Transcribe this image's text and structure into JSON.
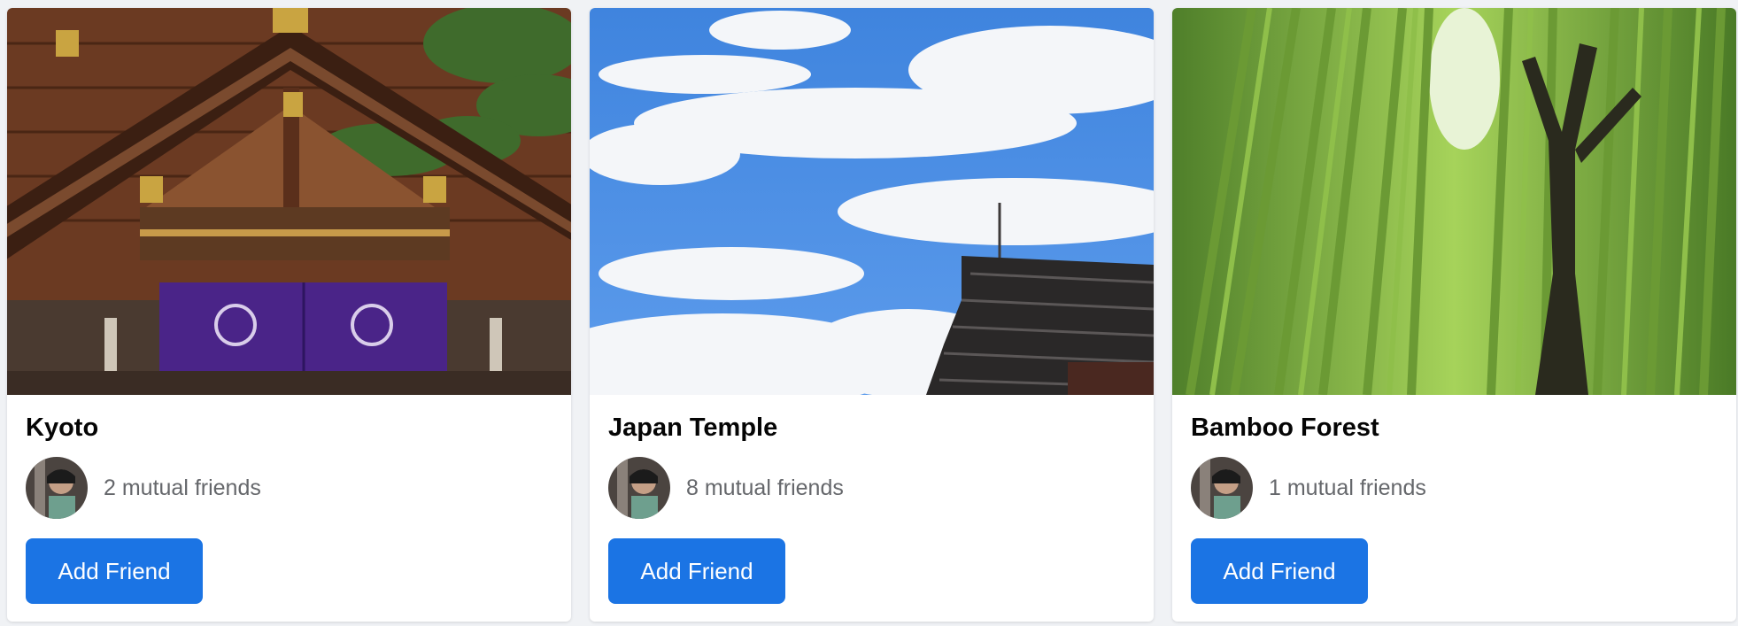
{
  "colors": {
    "page_background": "#f0f2f5",
    "card_background": "#ffffff",
    "title": "#050505",
    "secondary_text": "#65676b",
    "button": "#1b74e4",
    "button_text": "#ffffff"
  },
  "cards": [
    {
      "title": "Kyoto",
      "image": "shrine-gate-photo",
      "mutual_count": 2,
      "mutual_text": "2 mutual friends",
      "button_label": "Add Friend"
    },
    {
      "title": "Japan Temple",
      "image": "sky-temple-roof-photo",
      "mutual_count": 8,
      "mutual_text": "8 mutual friends",
      "button_label": "Add Friend"
    },
    {
      "title": "Bamboo Forest",
      "image": "bamboo-forest-photo",
      "mutual_count": 1,
      "mutual_text": "1 mutual friends",
      "button_label": "Add Friend"
    }
  ]
}
